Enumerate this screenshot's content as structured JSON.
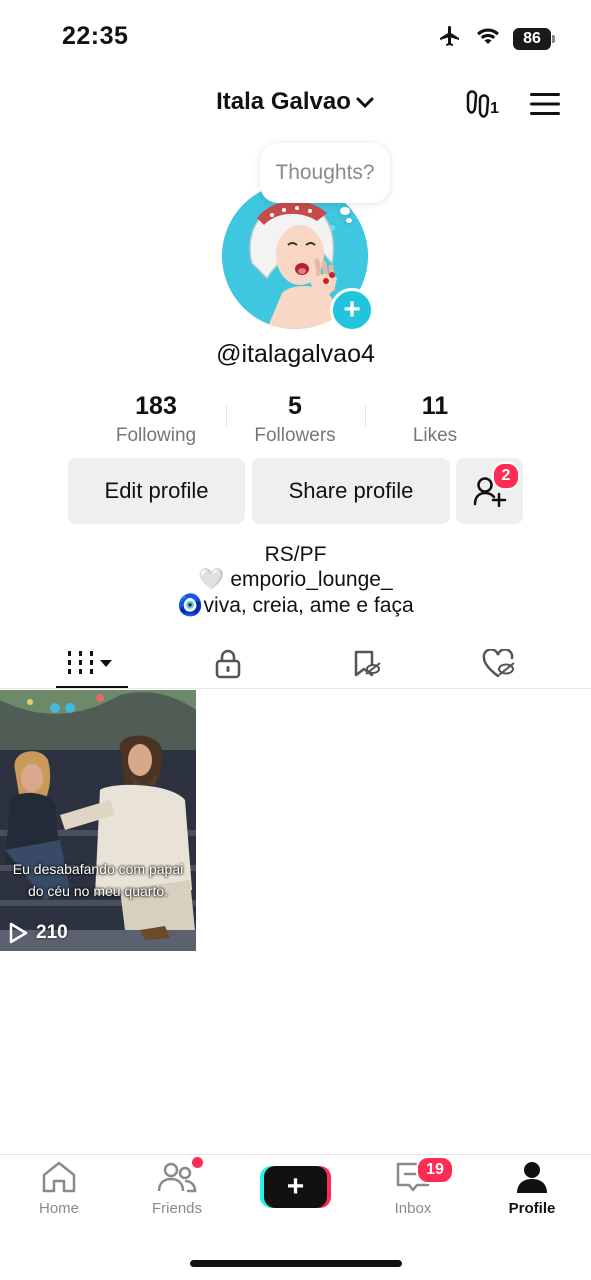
{
  "status_bar": {
    "time": "22:35",
    "battery": "86",
    "icons": [
      "airplane-icon",
      "wifi-icon",
      "battery-icon"
    ]
  },
  "header": {
    "display_name": "Itala Galvao",
    "footprint_count": "1"
  },
  "profile": {
    "thought_bubble": "Thoughts?",
    "username": "@italagalvao4"
  },
  "stats": [
    {
      "value": "183",
      "label": "Following"
    },
    {
      "value": "5",
      "label": "Followers"
    },
    {
      "value": "11",
      "label": "Likes"
    }
  ],
  "actions": {
    "edit": "Edit profile",
    "share": "Share profile",
    "friend_requests_badge": "2"
  },
  "bio": {
    "line1": "RS/PF",
    "line2_emoji": "🤍",
    "line2": " emporio_lounge_",
    "line3_emoji": "🧿",
    "line3": "viva, creia, ame e faça"
  },
  "tabs": [
    "videos",
    "private",
    "reposts",
    "liked"
  ],
  "videos": [
    {
      "caption": "Eu desabafando com papai do céu no meu quarto.",
      "views": "210"
    }
  ],
  "bottom_nav": {
    "home": "Home",
    "friends": "Friends",
    "inbox": "Inbox",
    "inbox_badge": "19",
    "profile": "Profile"
  },
  "colors": {
    "accent": "#fe2c55",
    "teal": "#25f4ee",
    "avatar_bg": "#3fc6e0"
  }
}
